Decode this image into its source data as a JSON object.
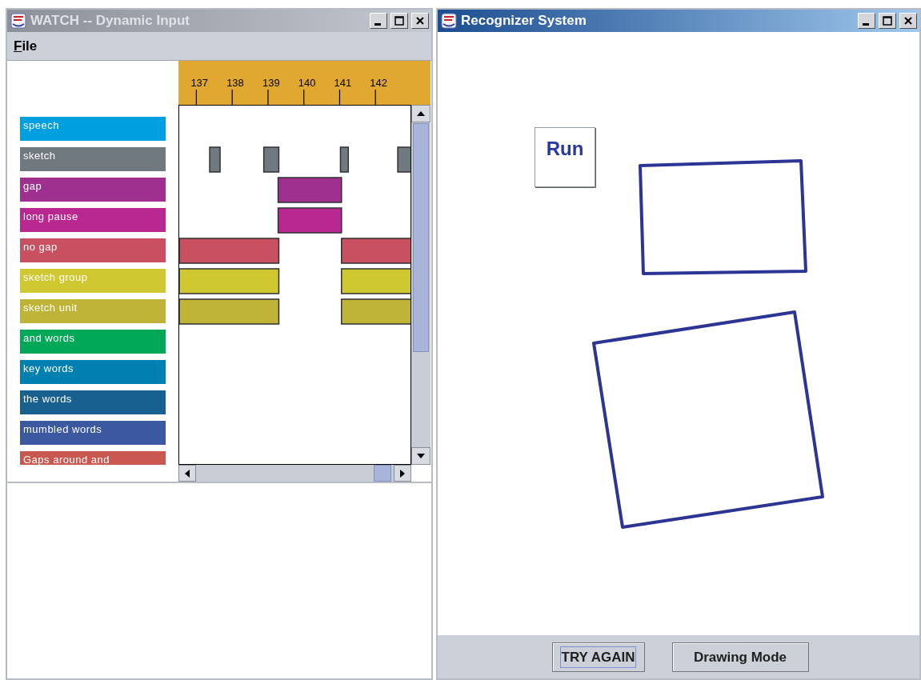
{
  "windows": [
    {
      "title": "WATCH -- Dynamic Input",
      "active": false,
      "menu": [
        {
          "label": "File"
        }
      ],
      "legend": [
        {
          "label": "speech",
          "color": "#00a0e0"
        },
        {
          "label": "sketch",
          "color": "#707880"
        },
        {
          "label": "gap",
          "color": "#a03090"
        },
        {
          "label": "long pause",
          "color": "#b82890"
        },
        {
          "label": "no gap",
          "color": "#c85060"
        },
        {
          "label": "sketch group",
          "color": "#d0c830"
        },
        {
          "label": "sketch unit",
          "color": "#c0b438"
        },
        {
          "label": "and words",
          "color": "#00a858"
        },
        {
          "label": "key words",
          "color": "#0080b0"
        },
        {
          "label": "the words",
          "color": "#186090"
        },
        {
          "label": "mumbled words",
          "color": "#3c58a0"
        },
        {
          "label": "Gaps around and",
          "color": "#c85850"
        }
      ],
      "ruler_ticks": [
        "137",
        "138",
        "139",
        "140",
        "141",
        "142"
      ]
    },
    {
      "title": "Recognizer System",
      "active": true,
      "run_button": "Run",
      "buttons": [
        {
          "label": "TRY AGAIN",
          "focused": true
        },
        {
          "label": "Drawing Mode",
          "focused": false
        }
      ]
    }
  ]
}
